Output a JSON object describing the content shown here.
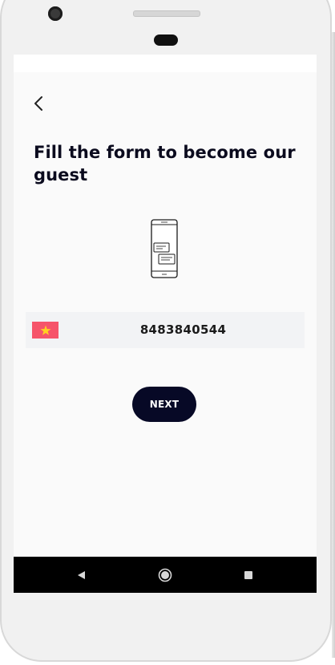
{
  "screen": {
    "title": "Fill the form to become our guest"
  },
  "phone_form": {
    "country_flag": "vietnam-flag-icon",
    "flag_colors": {
      "background": "#f6546a",
      "star": "#ffd21f"
    },
    "phone_number": "8483840544"
  },
  "actions": {
    "next_label": "NEXT"
  },
  "icons": {
    "back": "chevron-left-icon",
    "illustration": "phone-chat-icon",
    "nav_back": "triangle-back-icon",
    "nav_home": "circle-home-icon",
    "nav_recent": "square-recent-icon"
  },
  "colors": {
    "primary": "#070926",
    "title_text": "#0b0b1e",
    "input_background": "#f2f3f5",
    "screen_background": "#fafafa"
  }
}
